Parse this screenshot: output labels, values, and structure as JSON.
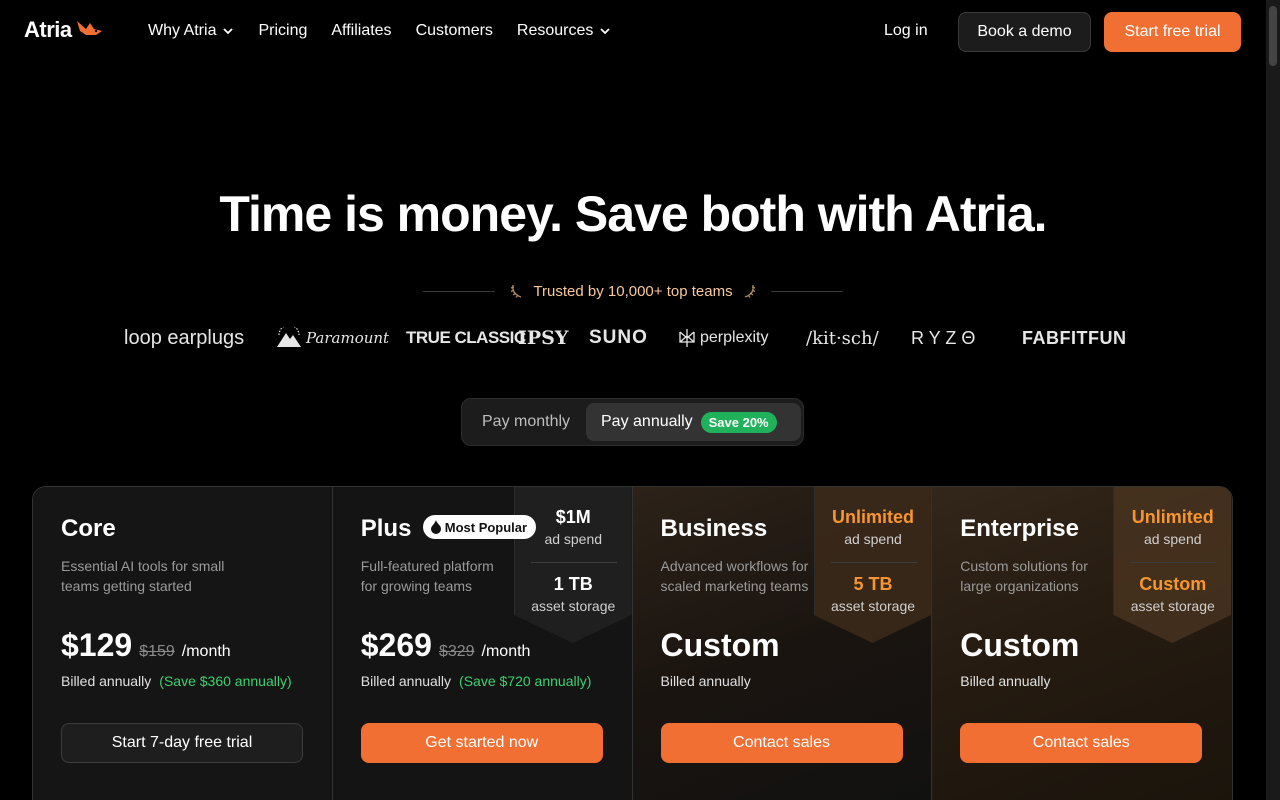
{
  "brand": {
    "name": "Atria",
    "accent": "#f26f33"
  },
  "nav": {
    "links": [
      {
        "label": "Why Atria",
        "dropdown": true
      },
      {
        "label": "Pricing",
        "dropdown": false
      },
      {
        "label": "Affiliates",
        "dropdown": false
      },
      {
        "label": "Customers",
        "dropdown": false
      },
      {
        "label": "Resources",
        "dropdown": true
      }
    ],
    "login": "Log in",
    "demo": "Book a demo",
    "trial": "Start free trial"
  },
  "hero": {
    "headline": "Time is money. Save both with Atria.",
    "trusted": "Trusted by 10,000+ top teams"
  },
  "logos": [
    "loop earplugs",
    "Paramount",
    "TRUE CLASSIC",
    "IPSY",
    "SUNO",
    "perplexity",
    "/kit·sch/",
    "R Y Z Θ",
    "FABFITFUN"
  ],
  "billing_toggle": {
    "monthly": "Pay monthly",
    "annual": "Pay annually",
    "badge": "Save 20%"
  },
  "plans": [
    {
      "name": "Core",
      "description": "Essential AI tools for small teams getting started",
      "price": "$129",
      "old_price": "$159",
      "unit": "/month",
      "billed": "Billed annually",
      "savings": "(Save $360 annually)",
      "cta": "Start 7-day free trial"
    },
    {
      "name": "Plus",
      "badge": "Most Popular",
      "description": "Full-featured platform for growing teams",
      "price": "$269",
      "old_price": "$329",
      "unit": "/month",
      "billed": "Billed annually",
      "savings": "(Save $720 annually)",
      "cta": "Get started now",
      "ad_spend": "$1M",
      "ad_spend_label": "ad spend",
      "storage": "1 TB",
      "storage_label": "asset storage"
    },
    {
      "name": "Business",
      "description": "Advanced workflows for scaled marketing teams",
      "price": "Custom",
      "billed": "Billed annually",
      "cta": "Contact sales",
      "ad_spend": "Unlimited",
      "ad_spend_label": "ad spend",
      "storage": "5 TB",
      "storage_label": "asset storage"
    },
    {
      "name": "Enterprise",
      "description": "Custom solutions for large organizations",
      "price": "Custom",
      "billed": "Billed annually",
      "cta": "Contact sales",
      "ad_spend": "Unlimited",
      "ad_spend_label": "ad spend",
      "storage": "Custom",
      "storage_label": "asset storage"
    }
  ]
}
